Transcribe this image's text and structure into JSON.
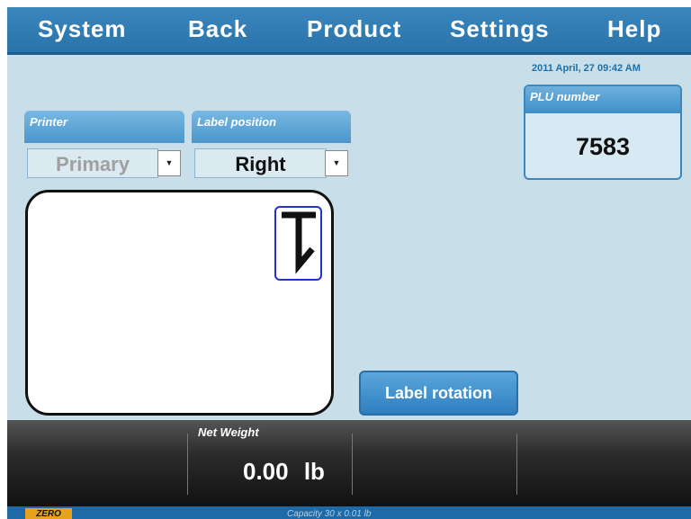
{
  "menu": {
    "items": [
      {
        "label": "System"
      },
      {
        "label": "Back"
      },
      {
        "label": "Product"
      },
      {
        "label": "Settings"
      },
      {
        "label": "Help"
      }
    ]
  },
  "datetime": "2011 April, 27 09:42 AM",
  "plu": {
    "label": "PLU number",
    "value": "7583"
  },
  "printer": {
    "label": "Printer",
    "value": "Primary"
  },
  "label_position": {
    "label": "Label position",
    "value": "Right"
  },
  "buttons": {
    "label_rotation": "Label rotation"
  },
  "weight": {
    "label": "Net Weight",
    "value": "0.00 lb"
  },
  "footer": {
    "zero": "ZERO",
    "capacity": "Capacity 30 x 0.01 lb"
  },
  "icons": {
    "dropdown": "chevron-down-icon",
    "rotation": "label-rotation-icon"
  },
  "colors": {
    "accent": "#2a73ab",
    "background": "#c8dfea",
    "zero_badge": "#e6a21a"
  }
}
